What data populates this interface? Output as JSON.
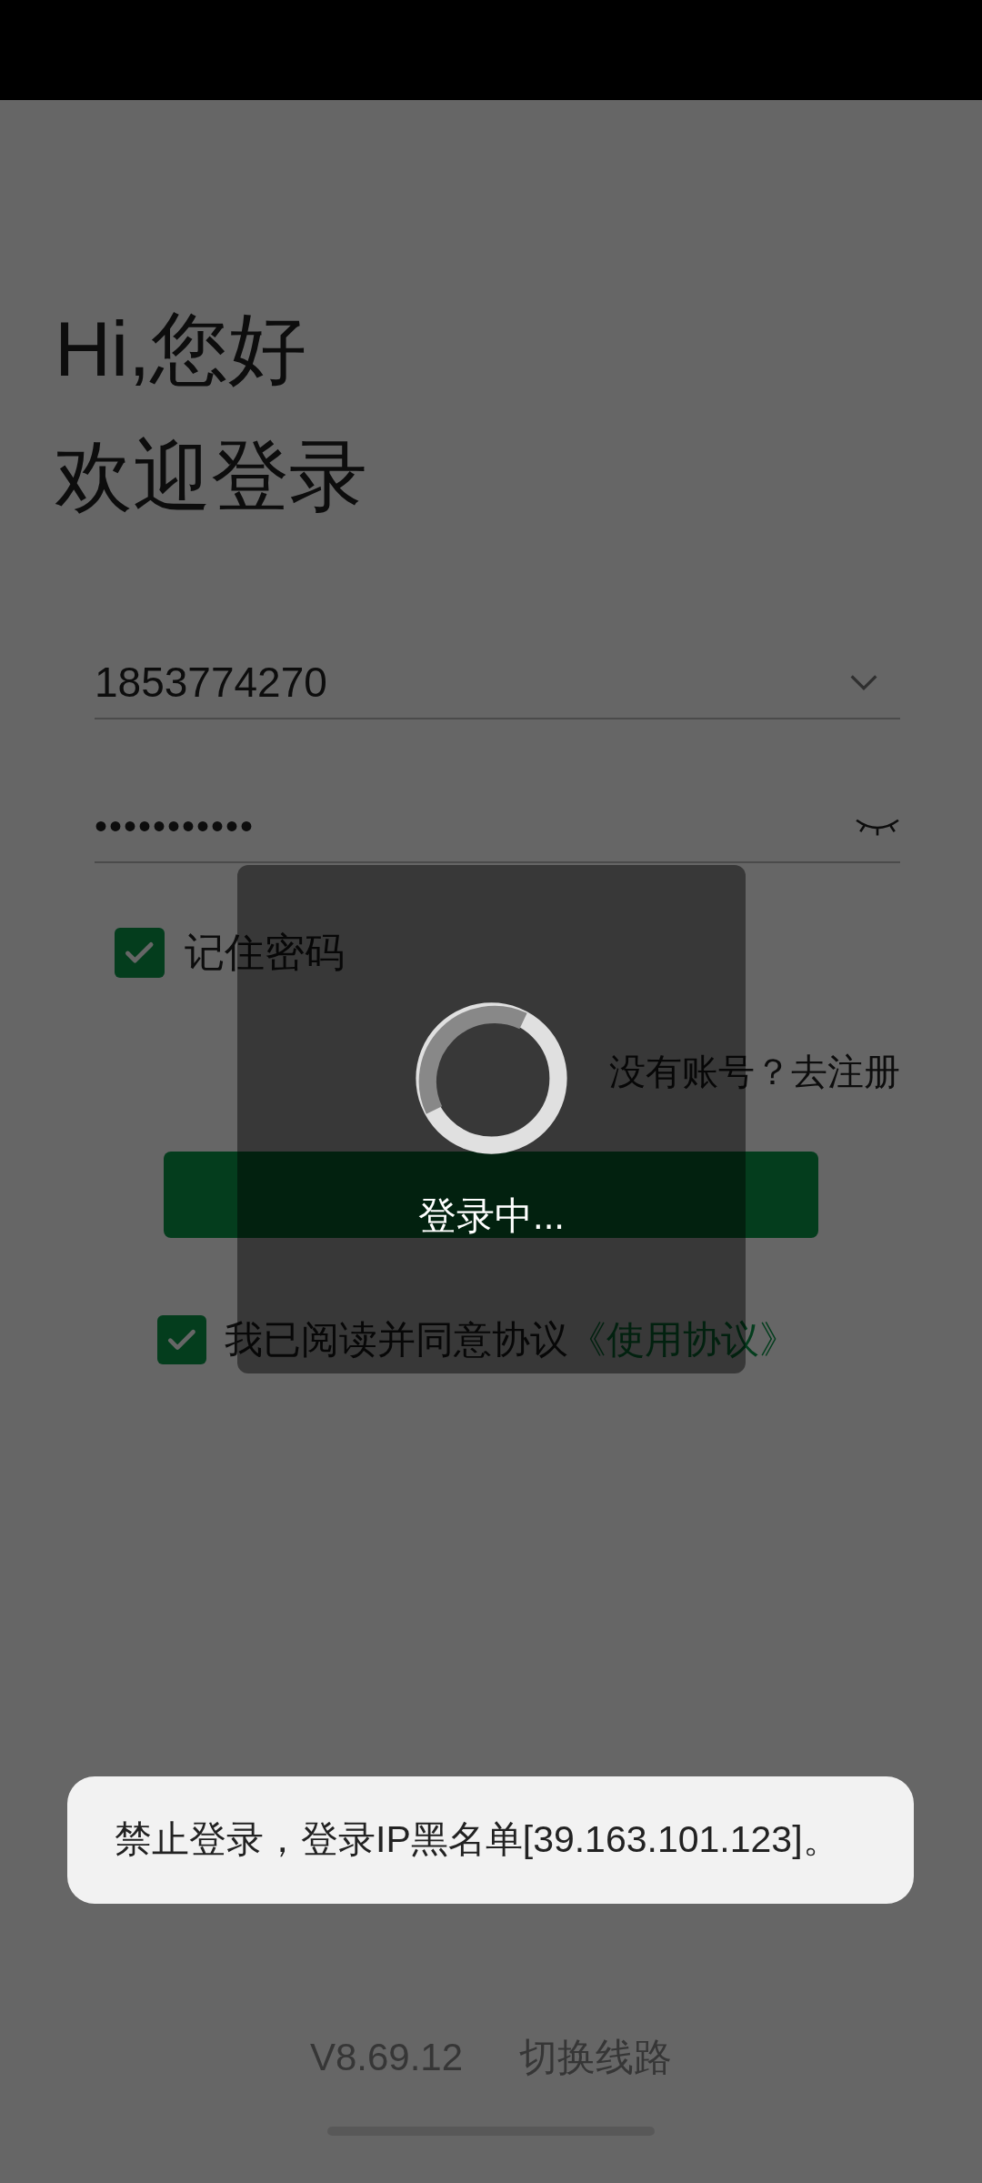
{
  "greeting": "Hi,您好",
  "welcome": "欢迎登录",
  "account": {
    "value": "1853774270"
  },
  "password": {
    "value": "•••••••••••"
  },
  "remember": {
    "label": "记住密码",
    "checked": true
  },
  "register_link": "没有账号？去注册",
  "agreement": {
    "checked": true,
    "text": "我已阅读并同意协议",
    "link": "《使用协议》"
  },
  "loading_dialog": {
    "text": "登录中..."
  },
  "toast": "禁止登录，登录IP黑名单[39.163.101.123]。",
  "footer": {
    "version": "V8.69.12",
    "switch_line": "切换线路"
  }
}
